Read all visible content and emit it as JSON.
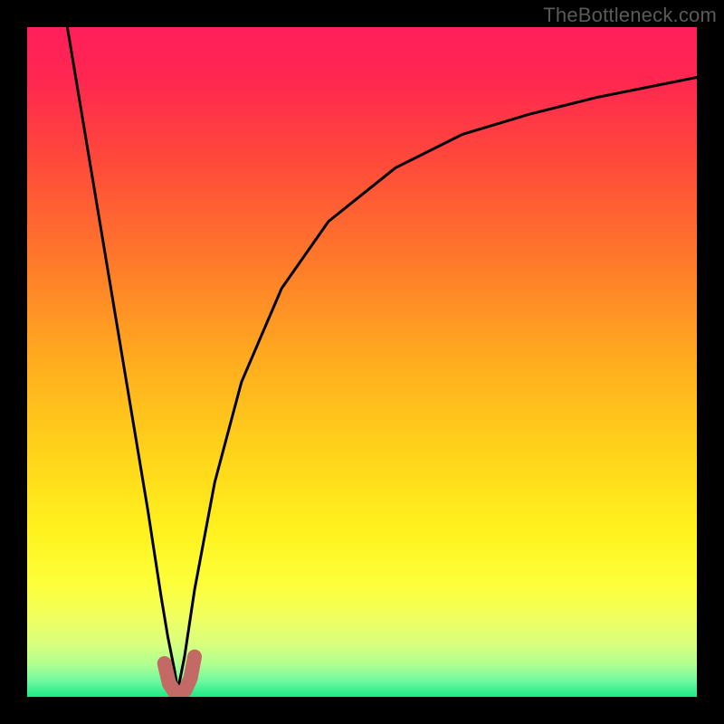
{
  "watermark": "TheBottleneck.com",
  "colors": {
    "frame": "#000000",
    "curve": "#000000",
    "foot": "#c46a66",
    "gradient_stops": [
      {
        "pct": 0.0,
        "color": "#ff1f5a"
      },
      {
        "pct": 0.08,
        "color": "#ff2850"
      },
      {
        "pct": 0.2,
        "color": "#ff4a3a"
      },
      {
        "pct": 0.35,
        "color": "#ff7a2a"
      },
      {
        "pct": 0.5,
        "color": "#ffad1e"
      },
      {
        "pct": 0.63,
        "color": "#ffd21a"
      },
      {
        "pct": 0.75,
        "color": "#fff21e"
      },
      {
        "pct": 0.83,
        "color": "#fcff3a"
      },
      {
        "pct": 0.88,
        "color": "#f0ff60"
      },
      {
        "pct": 0.92,
        "color": "#d8ff7e"
      },
      {
        "pct": 0.95,
        "color": "#b0ff90"
      },
      {
        "pct": 0.975,
        "color": "#70f8a0"
      },
      {
        "pct": 1.0,
        "color": "#18e884"
      }
    ]
  },
  "chart_data": {
    "type": "line",
    "title": "",
    "xlabel": "",
    "ylabel": "",
    "xlim": [
      0,
      1
    ],
    "ylim": [
      0,
      1
    ],
    "valley_x": 0.225,
    "series": [
      {
        "name": "left-branch",
        "x": [
          0.06,
          0.08,
          0.1,
          0.12,
          0.14,
          0.16,
          0.18,
          0.2,
          0.21,
          0.22,
          0.225
        ],
        "y": [
          1.0,
          0.88,
          0.76,
          0.64,
          0.52,
          0.4,
          0.28,
          0.15,
          0.09,
          0.04,
          0.01
        ]
      },
      {
        "name": "right-branch",
        "x": [
          0.225,
          0.235,
          0.25,
          0.28,
          0.32,
          0.38,
          0.45,
          0.55,
          0.65,
          0.75,
          0.85,
          0.95,
          1.0
        ],
        "y": [
          0.01,
          0.06,
          0.16,
          0.32,
          0.47,
          0.61,
          0.71,
          0.79,
          0.84,
          0.87,
          0.895,
          0.915,
          0.925
        ]
      },
      {
        "name": "valley-foot",
        "x": [
          0.205,
          0.212,
          0.22,
          0.228,
          0.236,
          0.244,
          0.25
        ],
        "y": [
          0.05,
          0.02,
          0.008,
          0.005,
          0.01,
          0.028,
          0.06
        ]
      }
    ]
  }
}
